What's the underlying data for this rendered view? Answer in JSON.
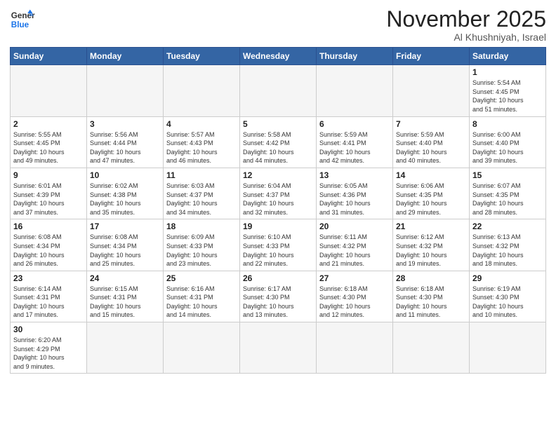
{
  "logo": {
    "line1": "General",
    "line2": "Blue"
  },
  "title": "November 2025",
  "location": "Al Khushniyah, Israel",
  "weekdays": [
    "Sunday",
    "Monday",
    "Tuesday",
    "Wednesday",
    "Thursday",
    "Friday",
    "Saturday"
  ],
  "weeks": [
    [
      {
        "day": "",
        "info": ""
      },
      {
        "day": "",
        "info": ""
      },
      {
        "day": "",
        "info": ""
      },
      {
        "day": "",
        "info": ""
      },
      {
        "day": "",
        "info": ""
      },
      {
        "day": "",
        "info": ""
      },
      {
        "day": "1",
        "info": "Sunrise: 5:54 AM\nSunset: 4:45 PM\nDaylight: 10 hours\nand 51 minutes."
      }
    ],
    [
      {
        "day": "2",
        "info": "Sunrise: 5:55 AM\nSunset: 4:45 PM\nDaylight: 10 hours\nand 49 minutes."
      },
      {
        "day": "3",
        "info": "Sunrise: 5:56 AM\nSunset: 4:44 PM\nDaylight: 10 hours\nand 47 minutes."
      },
      {
        "day": "4",
        "info": "Sunrise: 5:57 AM\nSunset: 4:43 PM\nDaylight: 10 hours\nand 46 minutes."
      },
      {
        "day": "5",
        "info": "Sunrise: 5:58 AM\nSunset: 4:42 PM\nDaylight: 10 hours\nand 44 minutes."
      },
      {
        "day": "6",
        "info": "Sunrise: 5:59 AM\nSunset: 4:41 PM\nDaylight: 10 hours\nand 42 minutes."
      },
      {
        "day": "7",
        "info": "Sunrise: 5:59 AM\nSunset: 4:40 PM\nDaylight: 10 hours\nand 40 minutes."
      },
      {
        "day": "8",
        "info": "Sunrise: 6:00 AM\nSunset: 4:40 PM\nDaylight: 10 hours\nand 39 minutes."
      }
    ],
    [
      {
        "day": "9",
        "info": "Sunrise: 6:01 AM\nSunset: 4:39 PM\nDaylight: 10 hours\nand 37 minutes."
      },
      {
        "day": "10",
        "info": "Sunrise: 6:02 AM\nSunset: 4:38 PM\nDaylight: 10 hours\nand 35 minutes."
      },
      {
        "day": "11",
        "info": "Sunrise: 6:03 AM\nSunset: 4:37 PM\nDaylight: 10 hours\nand 34 minutes."
      },
      {
        "day": "12",
        "info": "Sunrise: 6:04 AM\nSunset: 4:37 PM\nDaylight: 10 hours\nand 32 minutes."
      },
      {
        "day": "13",
        "info": "Sunrise: 6:05 AM\nSunset: 4:36 PM\nDaylight: 10 hours\nand 31 minutes."
      },
      {
        "day": "14",
        "info": "Sunrise: 6:06 AM\nSunset: 4:35 PM\nDaylight: 10 hours\nand 29 minutes."
      },
      {
        "day": "15",
        "info": "Sunrise: 6:07 AM\nSunset: 4:35 PM\nDaylight: 10 hours\nand 28 minutes."
      }
    ],
    [
      {
        "day": "16",
        "info": "Sunrise: 6:08 AM\nSunset: 4:34 PM\nDaylight: 10 hours\nand 26 minutes."
      },
      {
        "day": "17",
        "info": "Sunrise: 6:08 AM\nSunset: 4:34 PM\nDaylight: 10 hours\nand 25 minutes."
      },
      {
        "day": "18",
        "info": "Sunrise: 6:09 AM\nSunset: 4:33 PM\nDaylight: 10 hours\nand 23 minutes."
      },
      {
        "day": "19",
        "info": "Sunrise: 6:10 AM\nSunset: 4:33 PM\nDaylight: 10 hours\nand 22 minutes."
      },
      {
        "day": "20",
        "info": "Sunrise: 6:11 AM\nSunset: 4:32 PM\nDaylight: 10 hours\nand 21 minutes."
      },
      {
        "day": "21",
        "info": "Sunrise: 6:12 AM\nSunset: 4:32 PM\nDaylight: 10 hours\nand 19 minutes."
      },
      {
        "day": "22",
        "info": "Sunrise: 6:13 AM\nSunset: 4:32 PM\nDaylight: 10 hours\nand 18 minutes."
      }
    ],
    [
      {
        "day": "23",
        "info": "Sunrise: 6:14 AM\nSunset: 4:31 PM\nDaylight: 10 hours\nand 17 minutes."
      },
      {
        "day": "24",
        "info": "Sunrise: 6:15 AM\nSunset: 4:31 PM\nDaylight: 10 hours\nand 15 minutes."
      },
      {
        "day": "25",
        "info": "Sunrise: 6:16 AM\nSunset: 4:31 PM\nDaylight: 10 hours\nand 14 minutes."
      },
      {
        "day": "26",
        "info": "Sunrise: 6:17 AM\nSunset: 4:30 PM\nDaylight: 10 hours\nand 13 minutes."
      },
      {
        "day": "27",
        "info": "Sunrise: 6:18 AM\nSunset: 4:30 PM\nDaylight: 10 hours\nand 12 minutes."
      },
      {
        "day": "28",
        "info": "Sunrise: 6:18 AM\nSunset: 4:30 PM\nDaylight: 10 hours\nand 11 minutes."
      },
      {
        "day": "29",
        "info": "Sunrise: 6:19 AM\nSunset: 4:30 PM\nDaylight: 10 hours\nand 10 minutes."
      }
    ],
    [
      {
        "day": "30",
        "info": "Sunrise: 6:20 AM\nSunset: 4:29 PM\nDaylight: 10 hours\nand 9 minutes."
      },
      {
        "day": "",
        "info": ""
      },
      {
        "day": "",
        "info": ""
      },
      {
        "day": "",
        "info": ""
      },
      {
        "day": "",
        "info": ""
      },
      {
        "day": "",
        "info": ""
      },
      {
        "day": "",
        "info": ""
      }
    ]
  ]
}
